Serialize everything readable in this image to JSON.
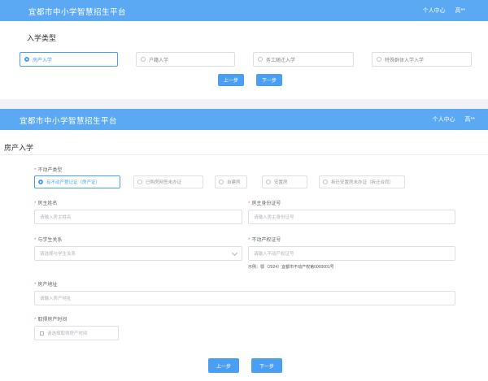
{
  "screen1": {
    "app_title": "宜都市中小学智慧招生平台",
    "user_center": "个人中心",
    "user_name": "高**",
    "section_title": "入学类型",
    "options": [
      "房产入学",
      "户籍入学",
      "务工随迁入学",
      "特殊群体入学入学"
    ],
    "selected_option": "房产入学",
    "prev_button": "上一步",
    "next_button": "下一步"
  },
  "screen2": {
    "app_title": "宜都市中小学智慧招生平台",
    "user_center": "个人中心",
    "user_name": "高**",
    "section_title": "房产入学",
    "property_type": {
      "label": "不动产类型",
      "options": [
        "有不动产登记证（房产证）",
        "已购房网签未办证",
        "自建房",
        "安置房",
        "拆迁安置房未办证（拆迁合同）"
      ],
      "selected": "有不动产登记证（房产证）"
    },
    "owner_name": {
      "label": "房主姓名",
      "placeholder": "请输入房主姓名"
    },
    "owner_id": {
      "label": "房主身份证号",
      "placeholder": "请输入房主身份证号"
    },
    "relation": {
      "label": "与学生关系",
      "placeholder": "请选择与学生关系"
    },
    "cert_no": {
      "label": "不动产权证号",
      "placeholder": "请输入不动产权证号",
      "hint": "示例：鄂（2024）宜都市不动产权第0000001号"
    },
    "address": {
      "label": "房产地址",
      "placeholder": "请输入房产地址"
    },
    "acquire_time": {
      "label": "取得房产时间",
      "placeholder": "请选择取得房产时间"
    },
    "prev_button": "上一步",
    "next_button": "下一步"
  },
  "colors": {
    "header": "#5aa9f2",
    "primary": "#4a9ff5",
    "required": "#f56c6c"
  }
}
